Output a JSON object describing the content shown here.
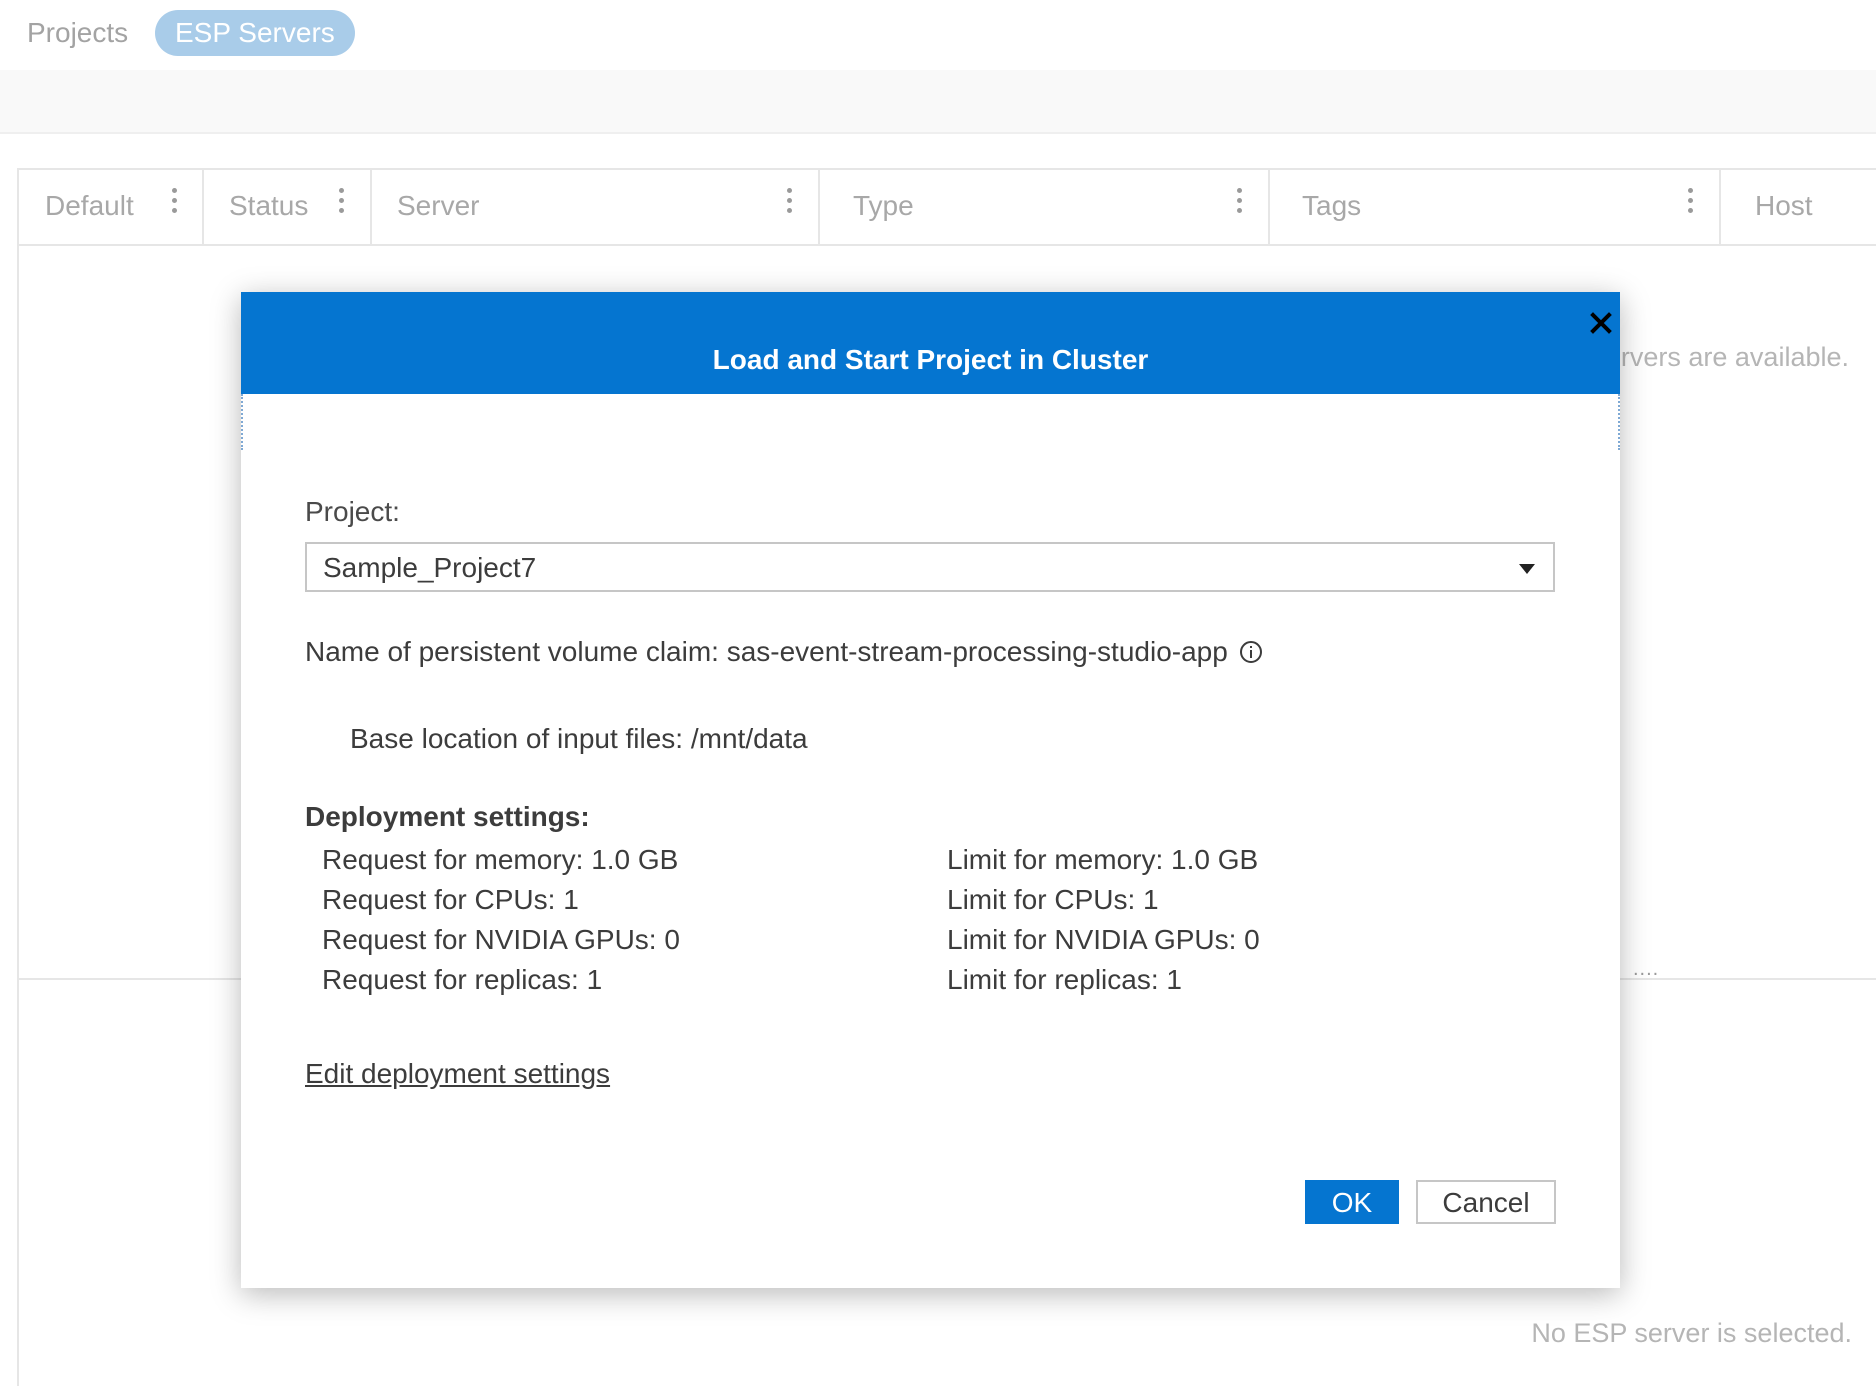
{
  "tabs": {
    "projects": "Projects",
    "esp_servers": "ESP Servers"
  },
  "table": {
    "columns": [
      "Default",
      "Status",
      "Server",
      "Type",
      "Tags",
      "Host"
    ],
    "empty_message": "No ESP servers are available.",
    "no_selection": "No ESP server is selected.",
    "splitter_dots": "...."
  },
  "modal": {
    "title": "Load and Start Project in Cluster",
    "project_label": "Project:",
    "project_value": "Sample_Project7",
    "pvc_text": "Name of persistent volume claim: sas-event-stream-processing-studio-app",
    "base_location": "Base location of input files: /mnt/data",
    "deployment_heading": "Deployment settings:",
    "requests": [
      "Request for memory: 1.0 GB",
      "Request for CPUs: 1",
      "Request for NVIDIA GPUs: 0",
      "Request for replicas: 1"
    ],
    "limits": [
      "Limit for memory: 1.0 GB",
      "Limit for CPUs: 1",
      "Limit for NVIDIA GPUs: 0",
      "Limit for replicas: 1"
    ],
    "edit_link": "Edit deployment settings",
    "ok_label": "OK",
    "cancel_label": "Cancel"
  },
  "icons": {
    "close": "close-icon",
    "dropdown": "chevron-down-icon",
    "info": "info-icon",
    "column_menu": "more-vertical-icon"
  },
  "colors": {
    "accent": "#0575d0",
    "tab_active_bg": "#a9cce9"
  }
}
